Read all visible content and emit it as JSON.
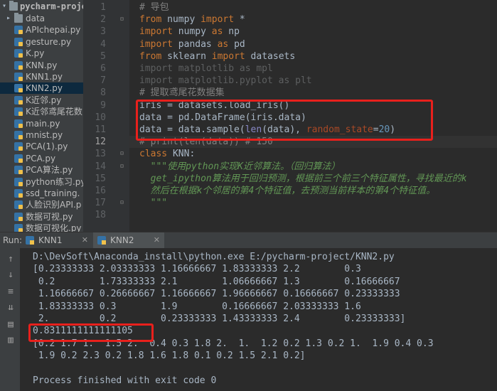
{
  "tree": {
    "root_label": "pycharm-proje",
    "items": [
      {
        "label": "data",
        "kind": "folder"
      },
      {
        "label": "APIchepai.py",
        "kind": "py"
      },
      {
        "label": "gesture.py",
        "kind": "py"
      },
      {
        "label": "K.py",
        "kind": "py"
      },
      {
        "label": "KNN.py",
        "kind": "py"
      },
      {
        "label": "KNN1.py",
        "kind": "py"
      },
      {
        "label": "KNN2.py",
        "kind": "py",
        "selected": true
      },
      {
        "label": "K近邻.py",
        "kind": "py"
      },
      {
        "label": "K近邻鸢尾花数",
        "kind": "py"
      },
      {
        "label": "main.py",
        "kind": "py"
      },
      {
        "label": "mnist.py",
        "kind": "py"
      },
      {
        "label": "PCA(1).py",
        "kind": "py"
      },
      {
        "label": "PCA.py",
        "kind": "py"
      },
      {
        "label": "PCA算法.py",
        "kind": "py"
      },
      {
        "label": "python练习.py",
        "kind": "py"
      },
      {
        "label": "ssd_training.",
        "kind": "py"
      },
      {
        "label": "人脸识别API.p",
        "kind": "py"
      },
      {
        "label": "数据可视.py",
        "kind": "py"
      },
      {
        "label": "数据可视化.py",
        "kind": "py"
      }
    ]
  },
  "editor": {
    "line_numbers": [
      "1",
      "2",
      "3",
      "4",
      "5",
      "6",
      "7",
      "8",
      "9",
      "10",
      "11",
      "12",
      "13",
      "14",
      "15",
      "16",
      "17",
      "18"
    ],
    "current_line": "12",
    "lines": [
      [
        {
          "t": "# 导包",
          "c": "cm"
        }
      ],
      [
        {
          "t": "from",
          "c": "kw"
        },
        {
          "t": " numpy ",
          "c": "n"
        },
        {
          "t": "import",
          "c": "kw"
        },
        {
          "t": " *",
          "c": "n"
        }
      ],
      [
        {
          "t": "import",
          "c": "kw"
        },
        {
          "t": " numpy ",
          "c": "n"
        },
        {
          "t": "as",
          "c": "kw"
        },
        {
          "t": " np",
          "c": "n"
        }
      ],
      [
        {
          "t": "import",
          "c": "kw"
        },
        {
          "t": " pandas ",
          "c": "n"
        },
        {
          "t": "as",
          "c": "kw"
        },
        {
          "t": " pd",
          "c": "n"
        }
      ],
      [
        {
          "t": "from",
          "c": "kw"
        },
        {
          "t": " sklearn ",
          "c": "n"
        },
        {
          "t": "import",
          "c": "kw"
        },
        {
          "t": " datasets",
          "c": "n"
        }
      ],
      [
        {
          "t": "import matplotlib as mpl",
          "c": "dim"
        }
      ],
      [
        {
          "t": "import matplotlib.pyplot as plt",
          "c": "dim"
        }
      ],
      [
        {
          "t": "# 提取鸢尾花数据集",
          "c": "cm"
        }
      ],
      [
        {
          "t": "iris = datasets.load_iris()",
          "c": "n"
        }
      ],
      [
        {
          "t": "data = pd.DataFrame(iris.data)",
          "c": "n"
        }
      ],
      [
        {
          "t": "data = data.sample(",
          "c": "n"
        },
        {
          "t": "len",
          "c": "bi"
        },
        {
          "t": "(data), ",
          "c": "n"
        },
        {
          "t": "random_state",
          "c": "kwarg"
        },
        {
          "t": "=",
          "c": "n"
        },
        {
          "t": "20",
          "c": "num"
        },
        {
          "t": ")",
          "c": "n"
        }
      ],
      [
        {
          "t": "# print(len(data)) # 150",
          "c": "cm"
        }
      ],
      [
        {
          "t": "class",
          "c": "kw"
        },
        {
          "t": " KNN:",
          "c": "n"
        }
      ],
      [
        {
          "t": "  \"\"\"使用python实现K近邻算法。（回归算法）",
          "c": "doc"
        }
      ],
      [
        {
          "t": "  get_ipython算法用于回归预测，根据前三个前三个特征属性，寻找最近的k",
          "c": "doc"
        }
      ],
      [
        {
          "t": "  然后在根据k个邻居的第4个特征值，去预测当前样本的第4个特征值。",
          "c": "doc"
        }
      ],
      [
        {
          "t": "  \"\"\"",
          "c": "doc"
        }
      ],
      [
        {
          "t": "",
          "c": "n"
        }
      ]
    ]
  },
  "run": {
    "label": "Run:",
    "tabs": [
      {
        "label": "KNN1",
        "active": false
      },
      {
        "label": "KNN2",
        "active": true
      }
    ],
    "side_icons": [
      "arrow-up-icon",
      "arrow-down-icon",
      "soft-wrap-icon",
      "scroll-to-end-icon",
      "print-icon",
      "trash-icon"
    ],
    "console_lines": [
      "D:\\DevSoft\\Anaconda_install\\python.exe E:/pycharm-project/KNN2.py",
      "[0.23333333 2.03333333 1.16666667 1.83333333 2.2        0.3",
      " 0.2        1.73333333 2.1        1.06666667 1.3        0.16666667",
      " 1.16666667 0.26666667 1.16666667 1.96666667 0.16666667 0.23333333",
      " 1.83333333 0.3        1.9        0.16666667 2.03333333 1.6",
      " 2.         0.2        0.23333333 1.43333333 2.4        0.23333333]",
      "0.8311111111111105",
      "[0.2 1.7 1.  1.5 2.  0.4 0.3 1.8 2.  1.  1.2 0.2 1.3 0.2 1.  1.9 0.4 0.3",
      " 1.9 0.2 2.3 0.2 1.8 1.6 1.8 0.1 0.2 1.5 2.1 0.2]",
      "",
      "Process finished with exit code 0"
    ]
  },
  "colors": {
    "highlight_box": "#e8201c",
    "keyword": "#cc7832",
    "comment": "#808080",
    "docstring": "#629755",
    "number": "#6897bb"
  }
}
